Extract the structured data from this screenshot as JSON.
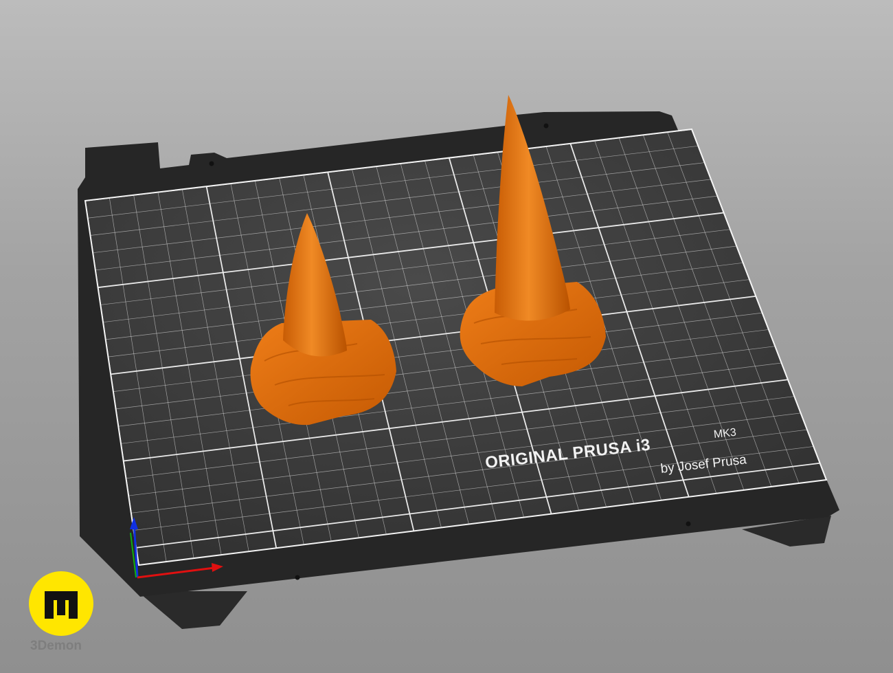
{
  "viewport": {
    "background_top": "#bcbcbc",
    "background_bottom": "#8f8f8f"
  },
  "bed": {
    "surface_color": "#3a3a3a",
    "frame_color": "#262626",
    "grid_color": "#f4f4f4",
    "brand": {
      "main": "ORIGINAL PRUSA i3",
      "model": "MK3",
      "author": "by Josef Prusa"
    }
  },
  "objects": [
    {
      "name": "small-horn",
      "color": "#e0710f"
    },
    {
      "name": "large-horn",
      "color": "#e0710f"
    }
  ],
  "axes": {
    "x_color": "#e01010",
    "y_color": "#10b010",
    "z_color": "#1030e0"
  },
  "logo": {
    "name": "3Demon",
    "badge_color": "#ffe600"
  }
}
